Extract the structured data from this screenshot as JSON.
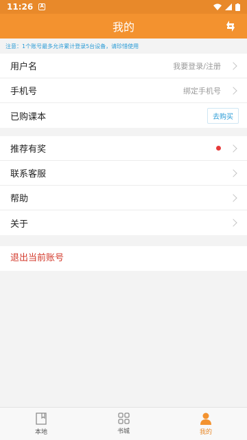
{
  "status_bar": {
    "time": "11:26",
    "notification": "A"
  },
  "header": {
    "title": "我的",
    "sync_icon": "sync-icon"
  },
  "notice": "注意：1个账号最多允许累计登录5台设备，请珍惜使用",
  "account": {
    "username": {
      "label": "用户名",
      "value": "我要登录/注册"
    },
    "phone": {
      "label": "手机号",
      "value": "绑定手机号"
    },
    "purchased": {
      "label": "已购课本",
      "button": "去购买"
    }
  },
  "menu": {
    "referral": {
      "label": "推荐有奖"
    },
    "support": {
      "label": "联系客服"
    },
    "help": {
      "label": "帮助"
    },
    "about": {
      "label": "关于"
    }
  },
  "logout_label": "退出当前账号",
  "bottom_nav": [
    {
      "label": "本地",
      "icon": "book-icon",
      "active": false
    },
    {
      "label": "书城",
      "icon": "grid-icon",
      "active": false
    },
    {
      "label": "我的",
      "icon": "person-icon",
      "active": true
    }
  ],
  "colors": {
    "accent": "#f3922f",
    "link": "#2a9bd6",
    "danger": "#d33a2c"
  }
}
